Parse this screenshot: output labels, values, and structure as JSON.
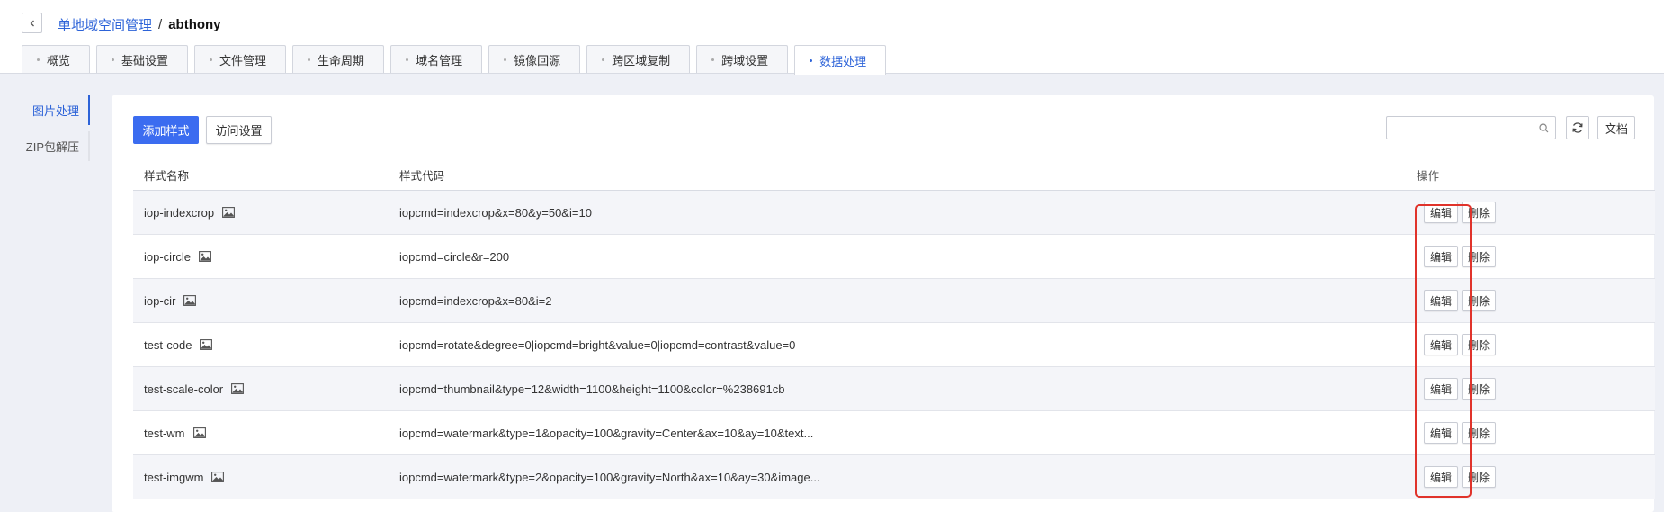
{
  "breadcrumb": {
    "parent": "单地域空间管理",
    "separator": "/",
    "current": "abthony"
  },
  "tabs": [
    {
      "label": "概览"
    },
    {
      "label": "基础设置"
    },
    {
      "label": "文件管理"
    },
    {
      "label": "生命周期"
    },
    {
      "label": "域名管理"
    },
    {
      "label": "镜像回源"
    },
    {
      "label": "跨区域复制"
    },
    {
      "label": "跨域设置"
    },
    {
      "label": "数据处理"
    }
  ],
  "active_tab": "数据处理",
  "sidenav": {
    "items": [
      {
        "label": "图片处理"
      },
      {
        "label": "ZIP包解压"
      }
    ],
    "active": "图片处理"
  },
  "toolbar": {
    "add_label": "添加样式",
    "access_label": "访问设置",
    "search_placeholder": "",
    "doc_label": "文档"
  },
  "table": {
    "columns": [
      "样式名称",
      "样式代码",
      "操作"
    ],
    "rows": [
      {
        "name": "iop-indexcrop",
        "code": "iopcmd=indexcrop&x=80&y=50&i=10"
      },
      {
        "name": "iop-circle",
        "code": "iopcmd=circle&r=200"
      },
      {
        "name": "iop-cir",
        "code": "iopcmd=indexcrop&x=80&i=2"
      },
      {
        "name": "test-code",
        "code": "iopcmd=rotate&degree=0|iopcmd=bright&value=0|iopcmd=contrast&value=0"
      },
      {
        "name": "test-scale-color",
        "code": "iopcmd=thumbnail&type=12&width=1100&height=1100&color=%238691cb"
      },
      {
        "name": "test-wm",
        "code": "iopcmd=watermark&type=1&opacity=100&gravity=Center&ax=10&ay=10&text..."
      },
      {
        "name": "test-imgwm",
        "code": "iopcmd=watermark&type=2&opacity=100&gravity=North&ax=10&ay=30&image..."
      }
    ],
    "edit_label": "编辑",
    "delete_label": "删除"
  },
  "colors": {
    "primary": "#3b6cf0",
    "link": "#2d63d8",
    "highlight": "#e0332b"
  }
}
